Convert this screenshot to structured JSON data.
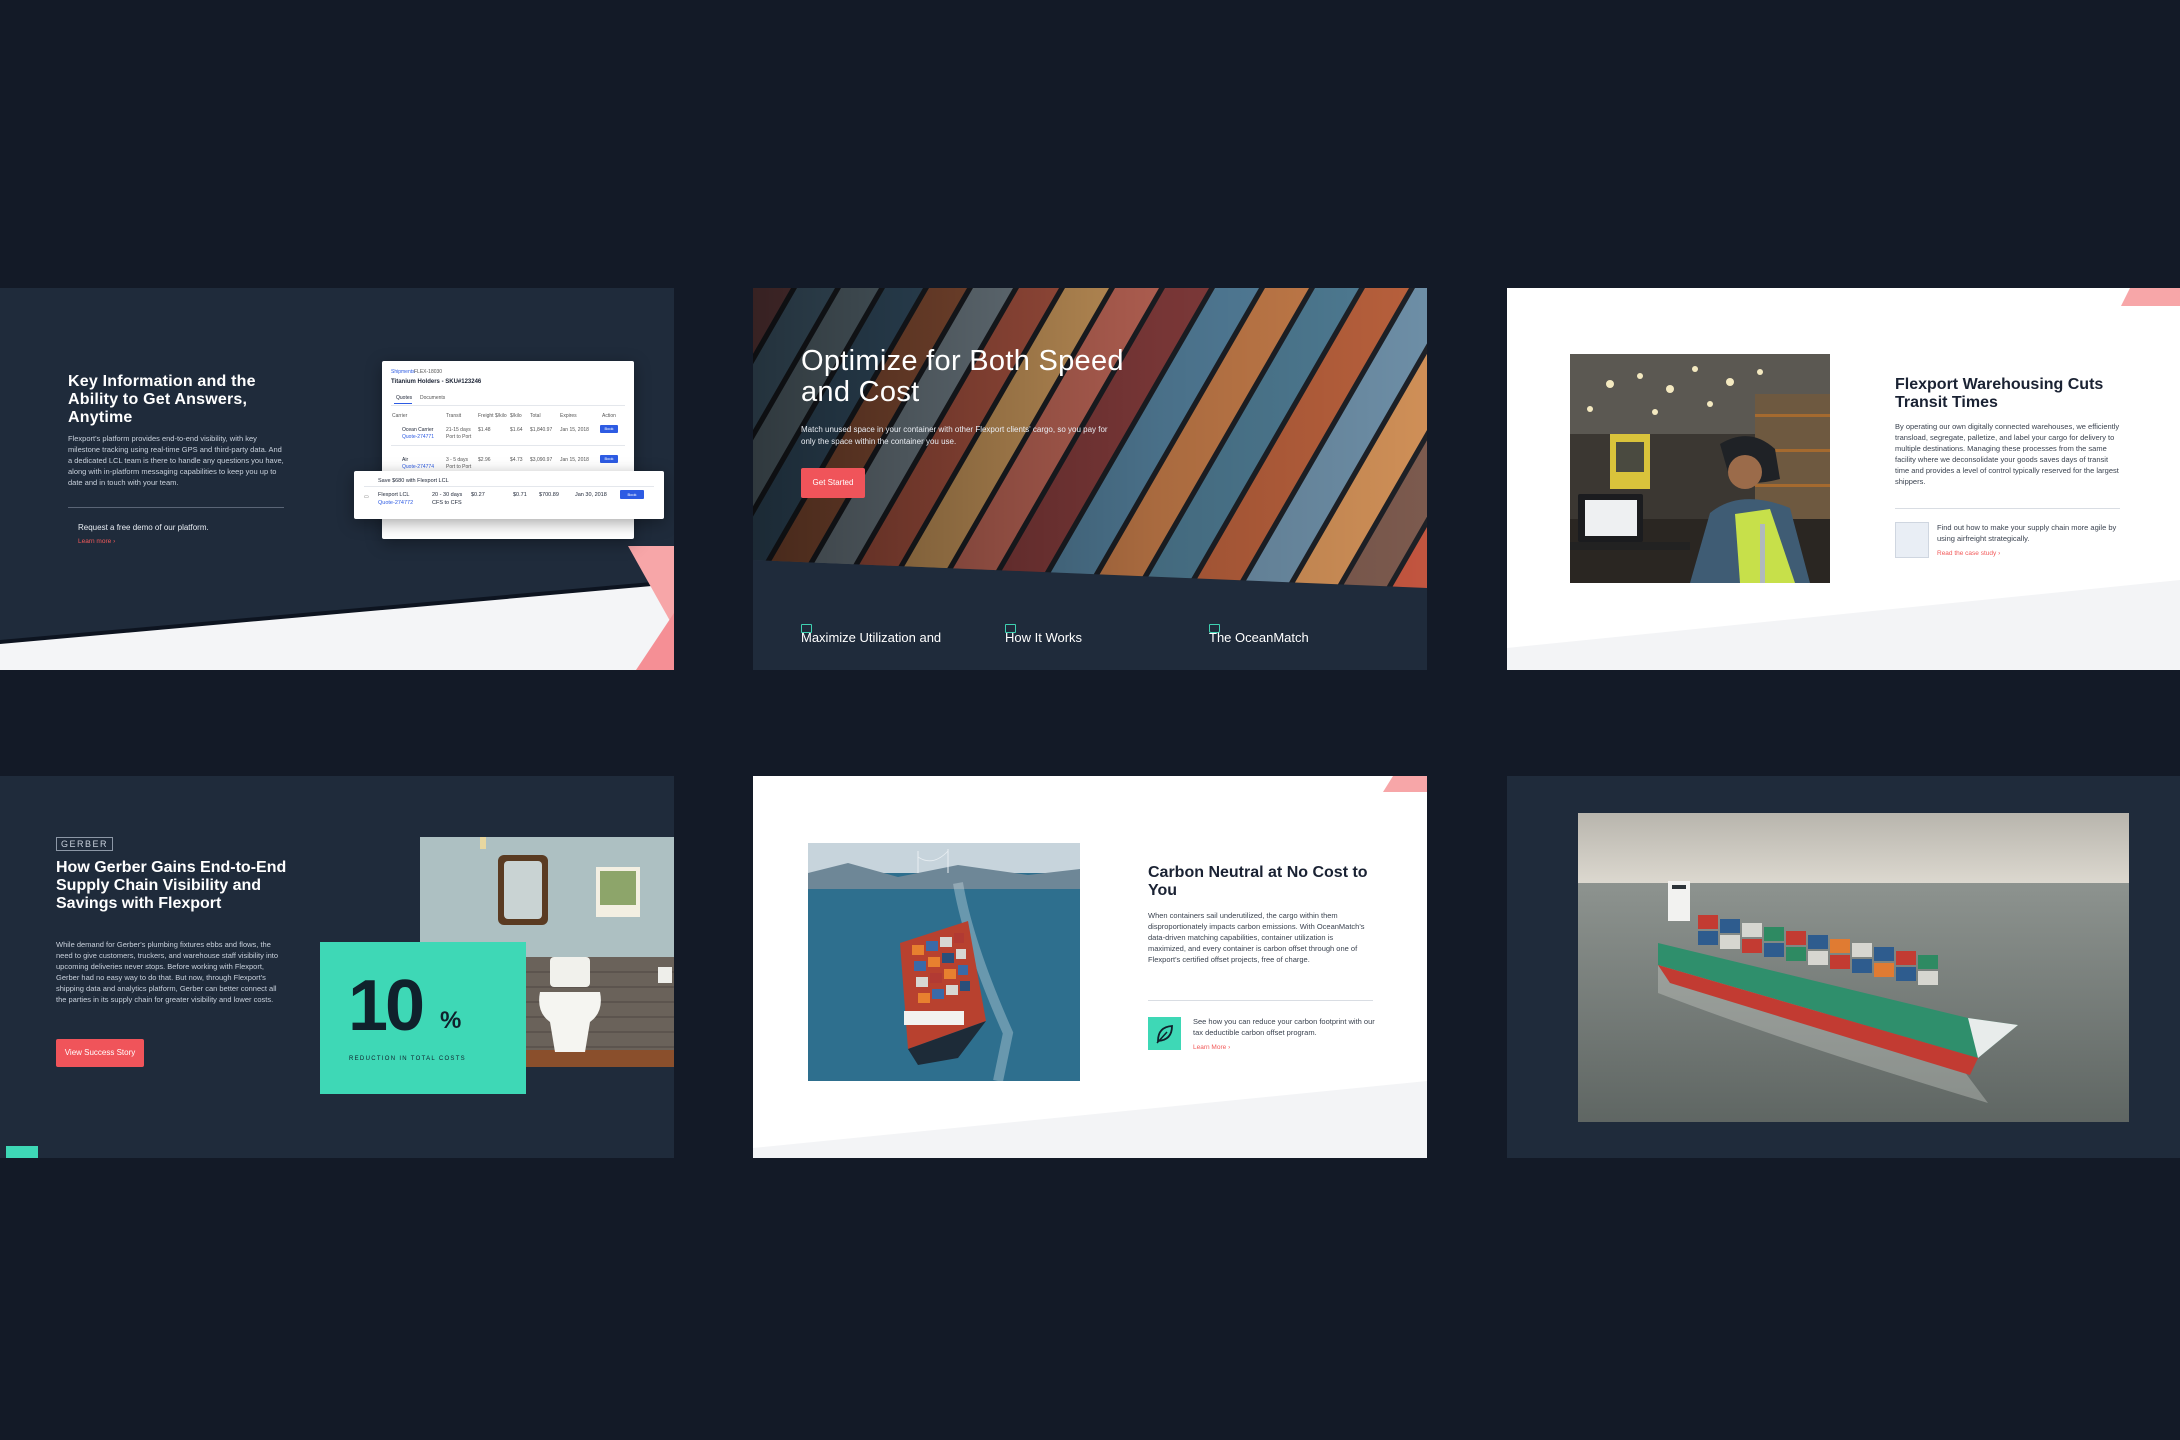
{
  "panel1": {
    "title": "Key Information and the Ability to Get Answers, Anytime",
    "body": "Flexport's platform provides end-to-end visibility, with key milestone tracking using real-time GPS and third-party data. And a dedicated LCL team is there to handle any questions you have, along with in-platform messaging capabilities to keep you up to date and in touch with your team.",
    "demo_text": "Request a free demo of our platform.",
    "learn_more": "Learn more",
    "mock": {
      "tabs": [
        "Shipments",
        "FLEX-18030"
      ],
      "header": "Titanium Holders - SKU#123246",
      "subtabs": [
        "Quotes",
        "Documents"
      ],
      "columns": [
        "Carrier",
        "Transit",
        "Freight $/kilo",
        "$/kilo",
        "Total",
        "Expires",
        "Action"
      ],
      "rows": [
        {
          "carrier": "Ocean Carrier",
          "quote": "Quote-274771",
          "transit": "21-15 days",
          "route": "Port to Port",
          "freight": "$1.48",
          "per": "$1.64",
          "total": "$1,840.97",
          "expires": "Jan 15, 2018",
          "action": "Book"
        },
        {
          "carrier": "Air",
          "quote": "Quote-274774",
          "transit": "3 - 5 days",
          "route": "Port to Port",
          "freight": "$2.96",
          "per": "$4.73",
          "total": "$3,090.97",
          "expires": "Jan 15, 2018",
          "action": "Book"
        }
      ],
      "popup": {
        "banner": "Save $680 with Flexport LCL",
        "carrier": "Flexport LCL",
        "quote": "Quote-274772",
        "transit": "20 - 30 days",
        "route": "CFS to CFS",
        "freight": "$0.27",
        "per": "$0.71",
        "total": "$700.89",
        "expires": "Jan 30, 2018",
        "action": "Book"
      }
    }
  },
  "panel2": {
    "title": "Optimize for Both Speed and Cost",
    "body": "Match unused space in your container with other Flexport clients' cargo, so you pay for only the space within the container you use.",
    "cta": "Get Started",
    "features": [
      "Maximize Utilization and",
      "How It Works",
      "The OceanMatch"
    ],
    "feature_icons": [
      "money-icon",
      "grid-icon",
      "lock-icon"
    ]
  },
  "panel3": {
    "title": "Flexport Warehousing Cuts Transit Times",
    "body": "By operating our own digitally connected warehouses, we efficiently transload, segregate, palletize, and label your cargo for delivery to multiple destinations. Managing these processes from the same facility where we deconsolidate your goods saves days of transit time and provides a level of control typically reserved for the largest shippers.",
    "case_text": "Find out how to make your supply chain more agile by using airfreight strategically.",
    "case_link": "Read the case study"
  },
  "panel4": {
    "brand": "GERBER",
    "title": "How Gerber Gains End-to-End Supply Chain Visibility and Savings with Flexport",
    "body": "While demand for Gerber's plumbing fixtures ebbs and flows, the need to give customers, truckers, and warehouse staff visibility into upcoming deliveries never stops. Before working with Flexport, Gerber had no easy way to do that. But now, through Flexport's shipping data and analytics platform, Gerber can better connect all the parties in its supply chain for greater visibility and lower costs.",
    "cta": "View Success Story",
    "stat_value": "10",
    "stat_unit": "%",
    "stat_label": "REDUCTION IN TOTAL COSTS"
  },
  "panel5": {
    "title": "Carbon Neutral at No Cost to You",
    "body": "When containers sail underutilized, the cargo within them disproportionately impacts carbon emissions. With OceanMatch's data-driven matching capabilities, container utilization is maximized, and every container is carbon offset through one of Flexport's certified offset projects, free of charge.",
    "offset_text": "See how you can reduce your carbon footprint with our tax deductible carbon offset program.",
    "learn_more": "Learn More"
  },
  "colors": {
    "page_bg": "#131a27",
    "panel_dark": "#1f2b3b",
    "accent_coral": "#f0545a",
    "accent_teal": "#3ed8b6",
    "accent_pink": "#f7a6a8"
  }
}
